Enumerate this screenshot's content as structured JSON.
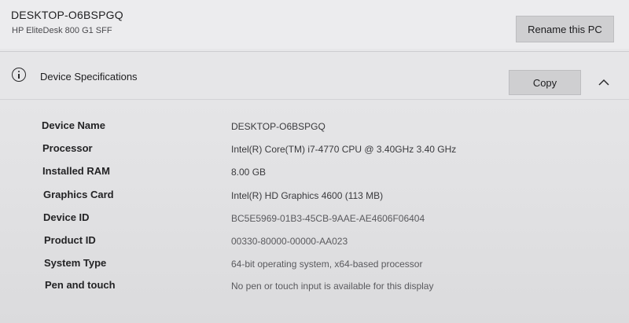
{
  "header": {
    "pc_name": "DESKTOP-O6BSPGQ",
    "model": "HP EliteDesk 800 G1 SFF",
    "rename_label": "Rename this PC"
  },
  "device_specifications": {
    "title": "Device Specifications",
    "copy_label": "Copy",
    "collapse_icon": "chevron-up-icon",
    "info_icon": "info-icon",
    "rows": [
      {
        "label": "Device Name",
        "value": "DESKTOP-O6BSPGQ"
      },
      {
        "label": "Processor",
        "value": "Intel(R) Core(TM) i7-4770 CPU @ 3.40GHz   3.40 GHz"
      },
      {
        "label": "Installed RAM",
        "value": "8.00 GB"
      },
      {
        "label": "Graphics Card",
        "value": "Intel(R) HD Graphics 4600 (113 MB)"
      },
      {
        "label": "Device ID",
        "value": "BC5E5969-01B3-45CB-9AAE-AE4606F06404"
      },
      {
        "label": "Product ID",
        "value": "00330-80000-00000-AA023"
      },
      {
        "label": "System Type",
        "value": "64-bit operating system, x64-based processor"
      },
      {
        "label": "Pen and touch",
        "value": "No pen or touch input is available for this display"
      }
    ]
  }
}
